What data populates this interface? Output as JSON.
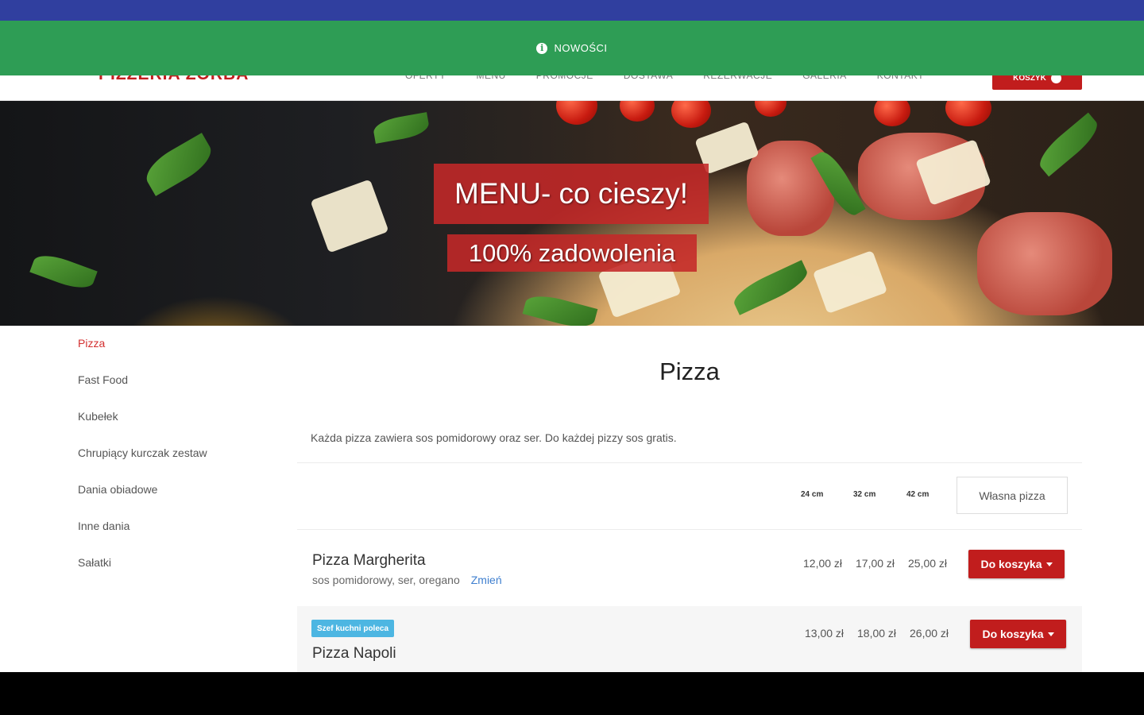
{
  "header": {
    "logo": "PIZZERIA ZORBA",
    "nav": [
      "OFERTY",
      "MENU",
      "PROMOCJE",
      "DOSTAWA",
      "REZERWACJE",
      "GALERIA",
      "KONTAKT"
    ],
    "cart_label": "KOSZYK"
  },
  "notice": {
    "text": "NOWOŚCI",
    "icon": "info-icon",
    "color": "#2e9d55"
  },
  "hero": {
    "title": "MENU- co cieszy!",
    "subtitle": "100% zadowolenia"
  },
  "sidebar": {
    "items": [
      "Pizza",
      "Fast Food",
      "Kubełek",
      "Chrupiący kurczak zestaw",
      "Dania obiadowe",
      "Inne dania",
      "Sałatki"
    ],
    "active_index": 0
  },
  "main": {
    "title": "Pizza",
    "description": "Każda pizza zawiera sos pomidorowy oraz ser. Do każdej pizzy sos gratis.",
    "sizes": [
      "24 cm",
      "32 cm",
      "42 cm"
    ],
    "custom_pizza_label": "Własna pizza",
    "items": [
      {
        "name": "Pizza Margherita",
        "ingredients": "sos pomidorowy, ser, oregano",
        "change_label": "Zmień",
        "prices": [
          "12,00 zł",
          "17,00 zł",
          "25,00 zł"
        ],
        "button": "Do koszyka"
      },
      {
        "badge": "Szef kuchni poleca",
        "name": "Pizza Napoli",
        "prices": [
          "13,00 zł",
          "18,00 zł",
          "26,00 zł"
        ],
        "button": "Do koszyka"
      }
    ]
  },
  "colors": {
    "topbar": "#303f9f",
    "accent_red": "#c11d1d",
    "badge": "#4db6e2"
  }
}
